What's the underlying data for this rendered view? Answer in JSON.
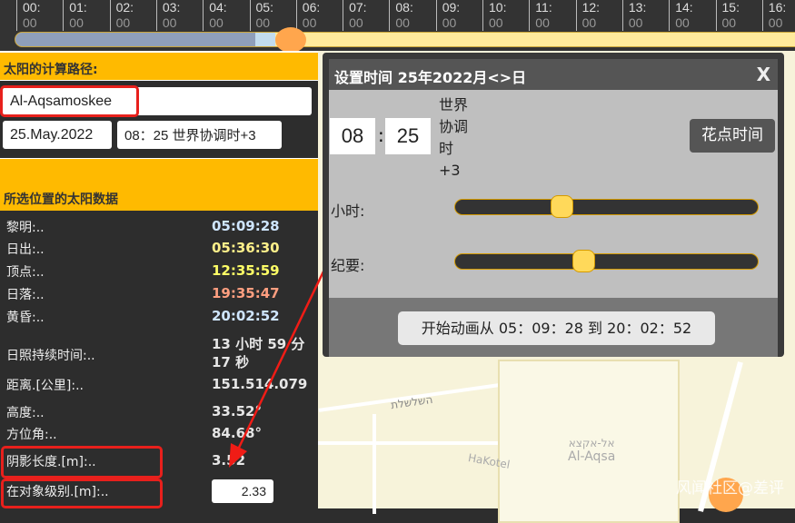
{
  "timeline": {
    "hours": [
      "00:",
      "01:",
      "02:",
      "03:",
      "04:",
      "05:",
      "06:",
      "07:",
      "08:",
      "09:",
      "10:",
      "11:",
      "12:",
      "13:",
      "14:",
      "15:",
      "16:"
    ],
    "minutes": "00",
    "current_hour_fraction": 0.351
  },
  "left": {
    "route_title": "太阳的计算路径:",
    "location": "Al-Aqsamoskee",
    "date": "25.May.2022",
    "time": "08：25 世界协调时+3",
    "data_title": "所选位置的太阳数据",
    "rows": [
      {
        "label": "黎明:..",
        "value": "05:09:28",
        "color": "#cfe6ff"
      },
      {
        "label": "日出:..",
        "value": "05:36:30",
        "color": "#fff08a"
      },
      {
        "label": "顶点:..",
        "value": "12:35:59",
        "color": "#ffff66"
      },
      {
        "label": "日落:..",
        "value": "19:35:47",
        "color": "#ff9f80"
      },
      {
        "label": "黄昏:..",
        "value": "20:02:52",
        "color": "#cfe6ff"
      },
      {
        "label": "日照持续时间:..",
        "value": "13 小时 59 分 17 秒",
        "color": "#e6e6e6"
      },
      {
        "label": "距离.[公里]:..",
        "value": "151.514.079",
        "color": "#e6e6e6"
      },
      {
        "label": "高度:..",
        "value": "33.52°",
        "color": "#e6e6e6"
      },
      {
        "label": "方位角:..",
        "value": "84.68°",
        "color": "#e6e6e6"
      },
      {
        "label": "阴影长度.[m]:..",
        "value": "3.52",
        "color": "#e6e6e6"
      }
    ],
    "object_level_label": "在对象级别.[m]:..",
    "object_level_value": "2.33"
  },
  "dialog": {
    "title": "设置时间 25年2022月<>日",
    "close": "X",
    "hour": "08",
    "minute": "25",
    "tz": [
      "世界",
      "协调",
      "时",
      "+3"
    ],
    "now_button": "花点时间",
    "hour_label": "小时:",
    "minute_label": "纪要:",
    "hour_slider_fraction": 0.35,
    "minute_slider_fraction": 0.42,
    "animate_button": "开始动画从 05：09：28 到 20：02：52"
  },
  "map": {
    "label_he": "אל-אקצא",
    "label_en": "Al-Aqsa",
    "street1": "HaKotel",
    "street2": "השלשלת"
  },
  "watermark": "风闻社区@差评"
}
